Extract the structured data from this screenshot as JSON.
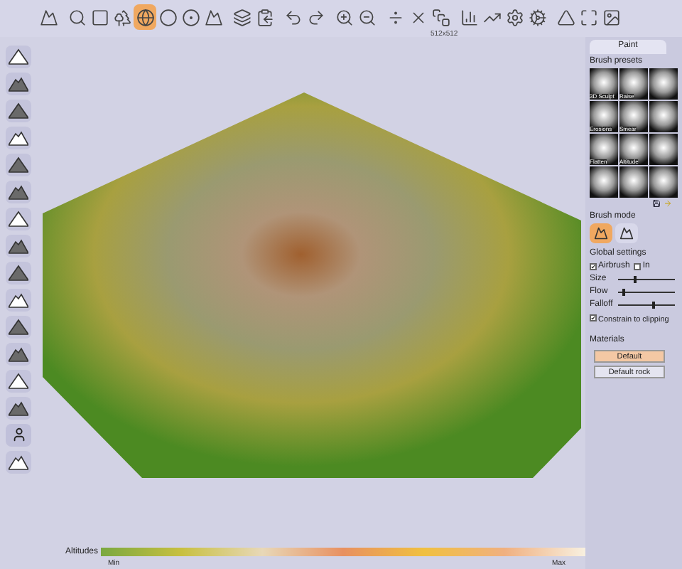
{
  "toolbar": {
    "buttons": [
      {
        "selected": false
      },
      {
        "selected": false
      },
      {
        "selected": false
      },
      {
        "selected": false
      },
      {
        "selected": true
      },
      {
        "selected": false
      },
      {
        "selected": false
      },
      {
        "selected": false
      },
      {
        "selected": false
      },
      {
        "selected": false
      },
      {
        "selected": false
      },
      {
        "selected": false
      },
      {
        "selected": false
      },
      {
        "selected": false
      },
      {
        "selected": false
      },
      {
        "selected": false
      },
      {
        "selected": false
      },
      {
        "selected": false
      },
      {
        "selected": false
      },
      {
        "selected": false
      },
      {
        "selected": false
      },
      {
        "selected": false
      },
      {
        "selected": false
      },
      {
        "selected": false
      }
    ],
    "resolution": "512x512"
  },
  "tabs": [
    {
      "label": "Paint",
      "selected": true
    }
  ],
  "brush_presets": {
    "title": "Brush presets",
    "items": [
      {
        "label": "3D Sculpt"
      },
      {
        "label": "Raise"
      },
      {
        "label": "Erosions"
      },
      {
        "label": "Smear"
      },
      {
        "label": "Flatten"
      },
      {
        "label": "Altitude"
      }
    ]
  },
  "brush_mode": {
    "title": "Brush mode",
    "modes": [
      {
        "selected": true
      },
      {
        "selected": false
      }
    ]
  },
  "global_settings": {
    "title": "Global settings",
    "checkboxes": [
      {
        "label": "Airbrush",
        "checked": true
      },
      {
        "label": "In",
        "checked": false
      }
    ],
    "sliders": [
      {
        "label": "Size",
        "level": 0.3
      },
      {
        "label": "Flow",
        "level": 0.08
      },
      {
        "label": "Falloff",
        "level": 0.62
      }
    ],
    "constrain": {
      "label": "Constrain to clipping",
      "checked": true
    }
  },
  "materials": {
    "title": "Materials",
    "items": [
      {
        "label": "Default",
        "selected": true
      },
      {
        "label": "Default rock",
        "selected": false
      }
    ]
  },
  "altitudes": {
    "label": "Altitudes",
    "min": "Min",
    "max": "Max"
  }
}
